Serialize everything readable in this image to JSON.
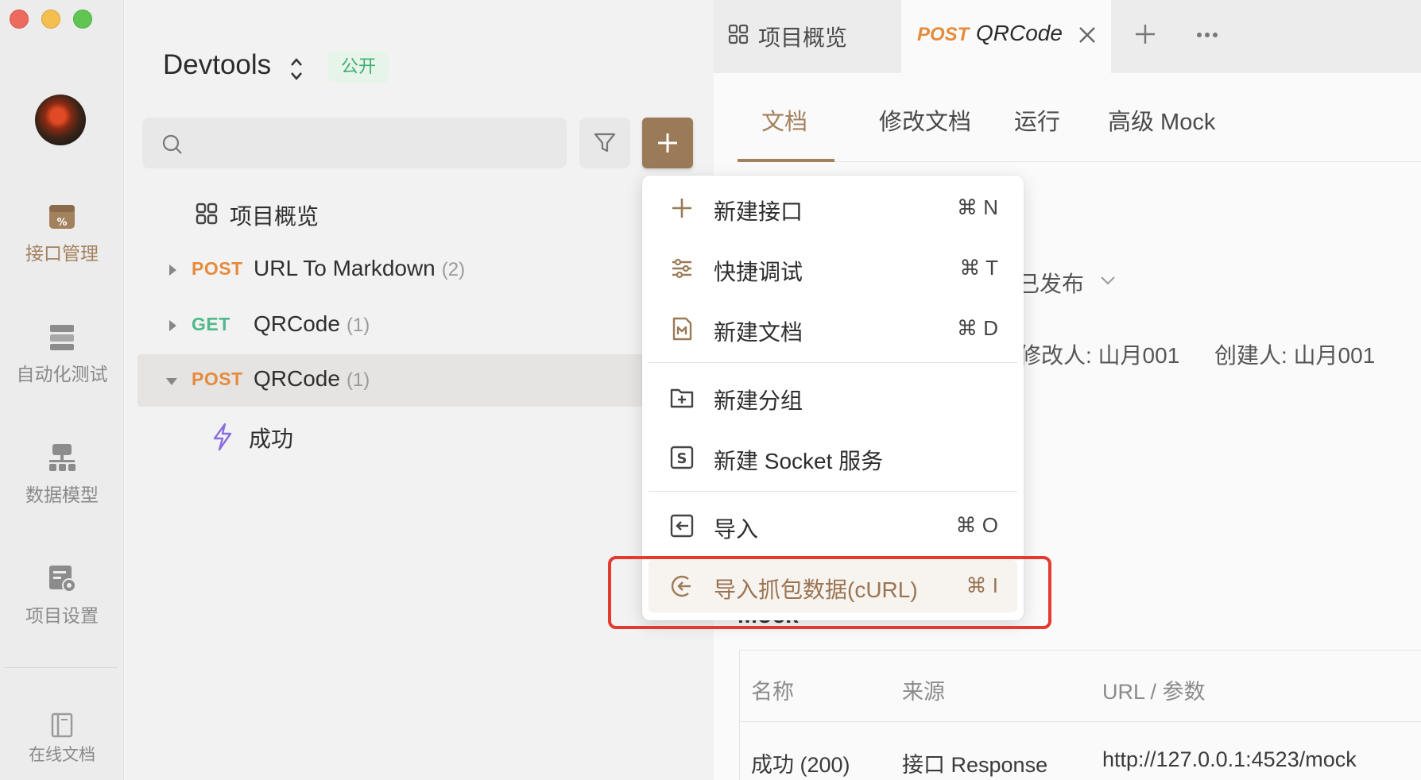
{
  "rail": {
    "items": [
      {
        "label": "接口管理",
        "icon": "api-management-icon"
      },
      {
        "label": "自动化测试",
        "icon": "automation-test-icon"
      },
      {
        "label": "数据模型",
        "icon": "data-model-icon"
      },
      {
        "label": "项目设置",
        "icon": "project-settings-icon"
      },
      {
        "label": "在线文档",
        "icon": "online-docs-icon"
      }
    ],
    "active_index": 0
  },
  "project": {
    "name": "Devtools",
    "visibility": "公开"
  },
  "search": {
    "placeholder": ""
  },
  "tree": {
    "overview": {
      "label": "项目概览"
    },
    "items": [
      {
        "method": "POST",
        "name": "URL To Markdown",
        "count": "(2)"
      },
      {
        "method": "GET",
        "name": "QRCode",
        "count": "(1)"
      },
      {
        "method": "POST",
        "name": "QRCode",
        "count": "(1)"
      }
    ],
    "child": {
      "label": "成功"
    }
  },
  "tabs": {
    "overview": "项目概览",
    "active": {
      "method": "POST",
      "name": "QRCode"
    }
  },
  "subtabs": [
    "文档",
    "修改文档",
    "运行",
    "高级 Mock"
  ],
  "doc": {
    "status": "已发布",
    "modifier": "修改人: 山月001",
    "creator": "创建人: 山月001",
    "mock_title": "Mock"
  },
  "mock_table": {
    "headers": [
      "名称",
      "来源",
      "URL / 参数"
    ],
    "row": [
      "成功 (200)",
      "接口 Response",
      "http://127.0.0.1:4523/mock"
    ]
  },
  "menu": {
    "items": [
      {
        "label": "新建接口",
        "shortcut": "⌘ N",
        "icon": "plus-icon"
      },
      {
        "label": "快捷调试",
        "shortcut": "⌘ T",
        "icon": "sliders-icon"
      },
      {
        "label": "新建文档",
        "shortcut": "⌘ D",
        "icon": "markdown-doc-icon"
      },
      {
        "label": "新建分组",
        "shortcut": "",
        "icon": "folder-plus-icon"
      },
      {
        "label": "新建 Socket 服务",
        "shortcut": "",
        "icon": "socket-icon"
      },
      {
        "label": "导入",
        "shortcut": "⌘ O",
        "icon": "import-icon"
      },
      {
        "label": "导入抓包数据(cURL)",
        "shortcut": "⌘ I",
        "icon": "import-capture-icon"
      }
    ],
    "highlighted_index": 6
  },
  "colors": {
    "accent": "#9a7a57",
    "post": "#e58b3d",
    "get": "#4fb98a",
    "highlight_box": "#e53a30",
    "public_badge": "#3fae72"
  }
}
